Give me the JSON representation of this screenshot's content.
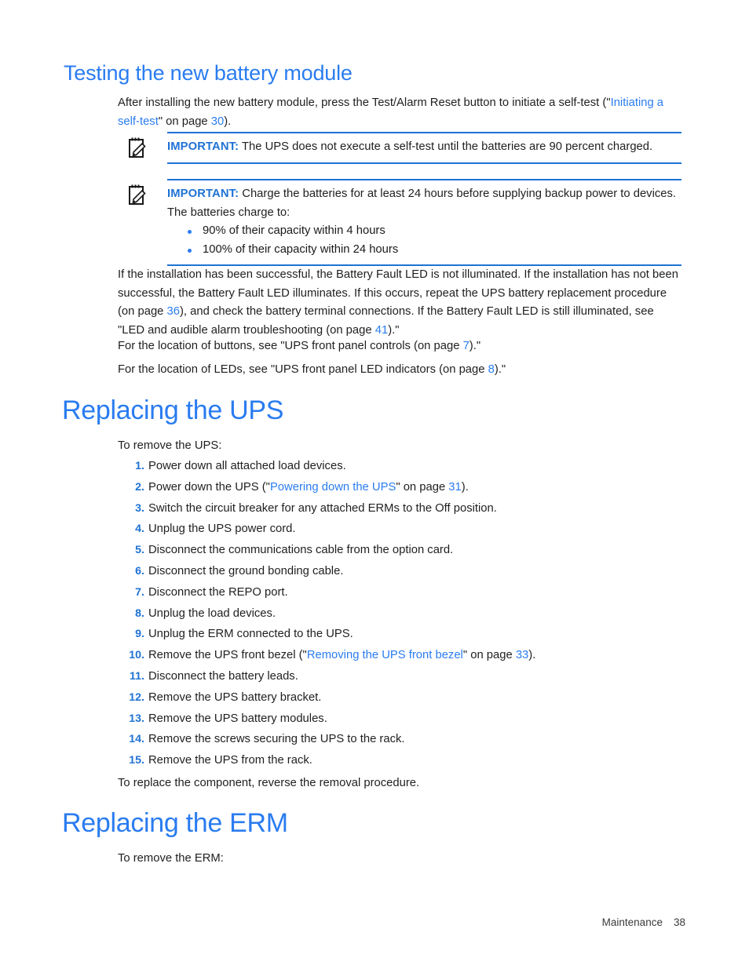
{
  "page": {
    "footer_section": "Maintenance",
    "footer_page_number": "38"
  },
  "colors": {
    "heading_blue": "#2a7cf0",
    "link_blue": "#2a7cf0",
    "rule_blue": "#1f72d4",
    "body_black": "#1f1f1f"
  },
  "sections": {
    "testing_battery": {
      "heading": "Testing the new battery module",
      "intro": {
        "before_link": "After installing the new battery module, press the Test/Alarm Reset button to initiate a self-test (\"",
        "link": "Initiating a self-test",
        "after_link": "\" on page ",
        "page_ref": "30",
        "tail": ")."
      },
      "notes": [
        {
          "icon": "note-pencil-icon",
          "label": "IMPORTANT:",
          "text": "The UPS does not execute a self-test until the batteries are 90 percent charged.",
          "bullets": []
        },
        {
          "icon": "note-pencil-icon",
          "label": "IMPORTANT:",
          "text": "Charge the batteries for at least 24 hours before supplying backup power to devices. The batteries charge to:",
          "bullets": [
            "90% of their capacity within 4 hours",
            "100% of their capacity within 24 hours"
          ]
        }
      ],
      "paragraph_result": {
        "part1": "If the installation has been successful, the Battery Fault LED is not illuminated. If the installation has not been successful, the Battery Fault LED illuminates. If this occurs, repeat the UPS battery replacement procedure (on page ",
        "page_ref1": "36",
        "part2": "), and check the battery terminal connections. If the Battery Fault LED is still illuminated, see \"LED and audible alarm troubleshooting (on page ",
        "page_ref2": "41",
        "part3": ").\""
      },
      "paragraph_buttons": {
        "part1": "For the location of buttons, see \"UPS front panel controls (on page ",
        "page_ref": "7",
        "part2": ").\""
      },
      "paragraph_leds": {
        "part1": "For the location of LEDs, see \"UPS front panel LED indicators (on page ",
        "page_ref": "8",
        "part2": ").\""
      }
    },
    "replacing_ups": {
      "heading": "Replacing the UPS",
      "intro": "To remove the UPS:",
      "steps": [
        {
          "num": "1.",
          "text": "Power down all attached load devices."
        },
        {
          "num": "2.",
          "text": "Power down the UPS (\"Powering down the UPS\" on page 31).",
          "rich": {
            "pre": "Power down the UPS (\"",
            "link": "Powering down the UPS",
            "mid": "\" on page ",
            "page": "31",
            "post": ")."
          }
        },
        {
          "num": "3.",
          "text": "Switch the circuit breaker for any attached ERMs to the Off position."
        },
        {
          "num": "4.",
          "text": "Unplug the UPS power cord."
        },
        {
          "num": "5.",
          "text": "Disconnect the communications cable from the option card."
        },
        {
          "num": "6.",
          "text": "Disconnect the ground bonding cable."
        },
        {
          "num": "7.",
          "text": "Disconnect the REPO port."
        },
        {
          "num": "8.",
          "text": "Unplug the load devices."
        },
        {
          "num": "9.",
          "text": "Unplug the ERM connected to the UPS."
        },
        {
          "num": "10.",
          "text": "Remove the UPS front bezel (\"Removing the UPS front bezel\" on page 33).",
          "rich": {
            "pre": "Remove the UPS front bezel (\"",
            "link": "Removing the UPS front bezel",
            "mid": "\" on page ",
            "page": "33",
            "post": ")."
          }
        },
        {
          "num": "11.",
          "text": "Disconnect the battery leads."
        },
        {
          "num": "12.",
          "text": "Remove the UPS battery bracket."
        },
        {
          "num": "13.",
          "text": "Remove the UPS battery modules."
        },
        {
          "num": "14.",
          "text": "Remove the screws securing the UPS to the rack."
        },
        {
          "num": "15.",
          "text": "Remove the UPS from the rack."
        }
      ],
      "closing": "To replace the component, reverse the removal procedure."
    },
    "replacing_erm": {
      "heading": "Replacing the ERM",
      "intro": "To remove the ERM:"
    }
  }
}
